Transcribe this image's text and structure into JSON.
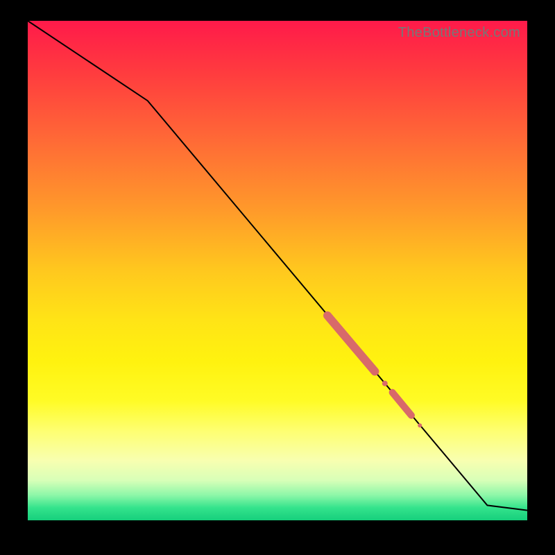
{
  "watermark": "TheBottleneck.com",
  "chart_data": {
    "type": "line",
    "title": "",
    "xlabel": "",
    "ylabel": "",
    "xlim": [
      0,
      100
    ],
    "ylim": [
      0,
      100
    ],
    "grid": false,
    "legend": false,
    "series": [
      {
        "name": "curve",
        "x": [
          0,
          24,
          92,
          100
        ],
        "y": [
          100,
          84,
          3,
          2
        ]
      }
    ],
    "markers": [
      {
        "kind": "rounded-segment",
        "x0": 60.0,
        "y0": 41.0,
        "x1": 69.5,
        "y1": 29.8,
        "width": 12
      },
      {
        "kind": "dot",
        "x": 71.5,
        "y": 27.4,
        "r": 4
      },
      {
        "kind": "rounded-segment",
        "x0": 73.0,
        "y0": 25.6,
        "x1": 76.8,
        "y1": 21.0,
        "width": 10
      },
      {
        "kind": "dot",
        "x": 78.5,
        "y": 19.0,
        "r": 3
      }
    ],
    "background": {
      "type": "vertical-gradient",
      "top_color": "#ff1a4a",
      "bottom_color": "#16cf7c"
    }
  }
}
